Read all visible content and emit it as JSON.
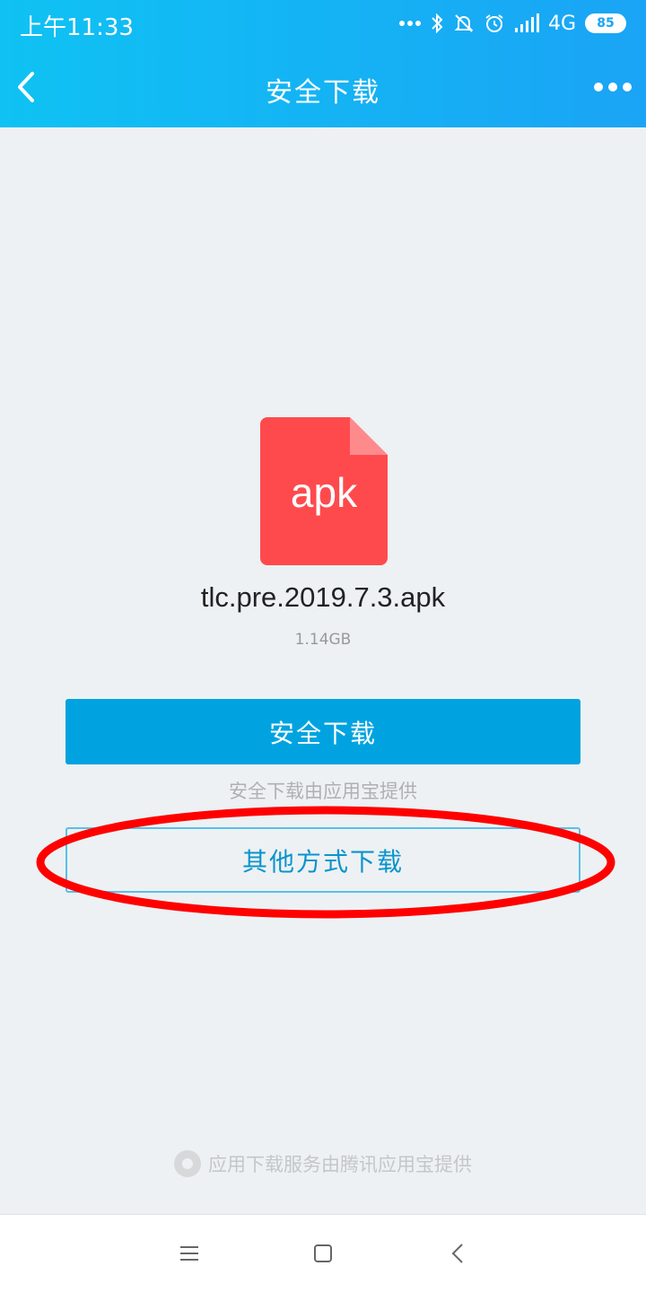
{
  "status_bar": {
    "time": "上午11:33",
    "network": "4G",
    "battery": "85",
    "icons": [
      "more-dots-icon",
      "bluetooth-icon",
      "mute-icon",
      "alarm-icon",
      "signal-icon",
      "battery-icon"
    ]
  },
  "nav": {
    "title": "安全下载",
    "back_icon": "back-chevron-icon",
    "more_icon": "more-icon"
  },
  "file": {
    "icon_label": "apk",
    "name": "tlc.pre.2019.7.3.apk",
    "size": "1.14GB"
  },
  "actions": {
    "safe_download": "安全下载",
    "hint": "安全下载由应用宝提供",
    "other_download": "其他方式下载"
  },
  "footer": {
    "credit": "应用下载服务由腾讯应用宝提供"
  },
  "colors": {
    "primary": "#00a3e0",
    "header_start": "#0fc2f3",
    "header_end": "#1aa4f5",
    "file_icon": "#ff4a4d",
    "annotation": "#ff0000",
    "background": "#edf1f4"
  }
}
